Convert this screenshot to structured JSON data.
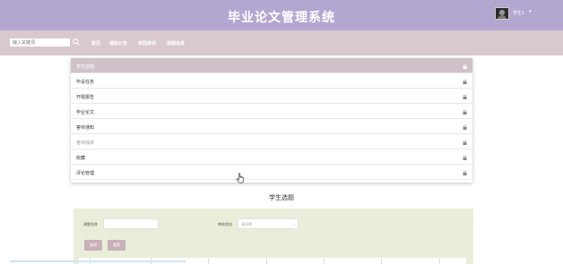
{
  "header": {
    "site_title": "毕业论文管理系统",
    "user_name": "学生1",
    "user_caret": "▾"
  },
  "navbar": {
    "search_placeholder": "输入关键词",
    "links": [
      "首页",
      "通知公告",
      "校园资讯",
      "课题信息"
    ]
  },
  "dropdown": {
    "items": [
      {
        "label": "学生选题",
        "state": "active"
      },
      {
        "label": "毕设任务",
        "state": "normal"
      },
      {
        "label": "开题报告",
        "state": "normal"
      },
      {
        "label": "毕业论文",
        "state": "normal"
      },
      {
        "label": "答辩通知",
        "state": "normal"
      },
      {
        "label": "答辩成绩",
        "state": "muted"
      },
      {
        "label": "收藏",
        "state": "normal"
      },
      {
        "label": "评论管理",
        "state": "normal"
      }
    ]
  },
  "main": {
    "section_title": "学生选题",
    "filters": {
      "topic_name_label": "课题名称",
      "review_status_label": "审核状态",
      "review_status_value": "请选择",
      "review_status_caret": "⌄",
      "search_button": "查询",
      "reset_button": "重置"
    }
  },
  "colors": {
    "header_bg": "#b3a7d1",
    "navbar_bg": "#d8c9cd",
    "active_item_bg": "#cfc2c8",
    "filter_panel_bg": "#e9eedb",
    "button_bg": "#cab0b9"
  },
  "icons": {
    "search": "search-icon",
    "lock": "lock-icon",
    "cursor": "hand-cursor-icon"
  }
}
